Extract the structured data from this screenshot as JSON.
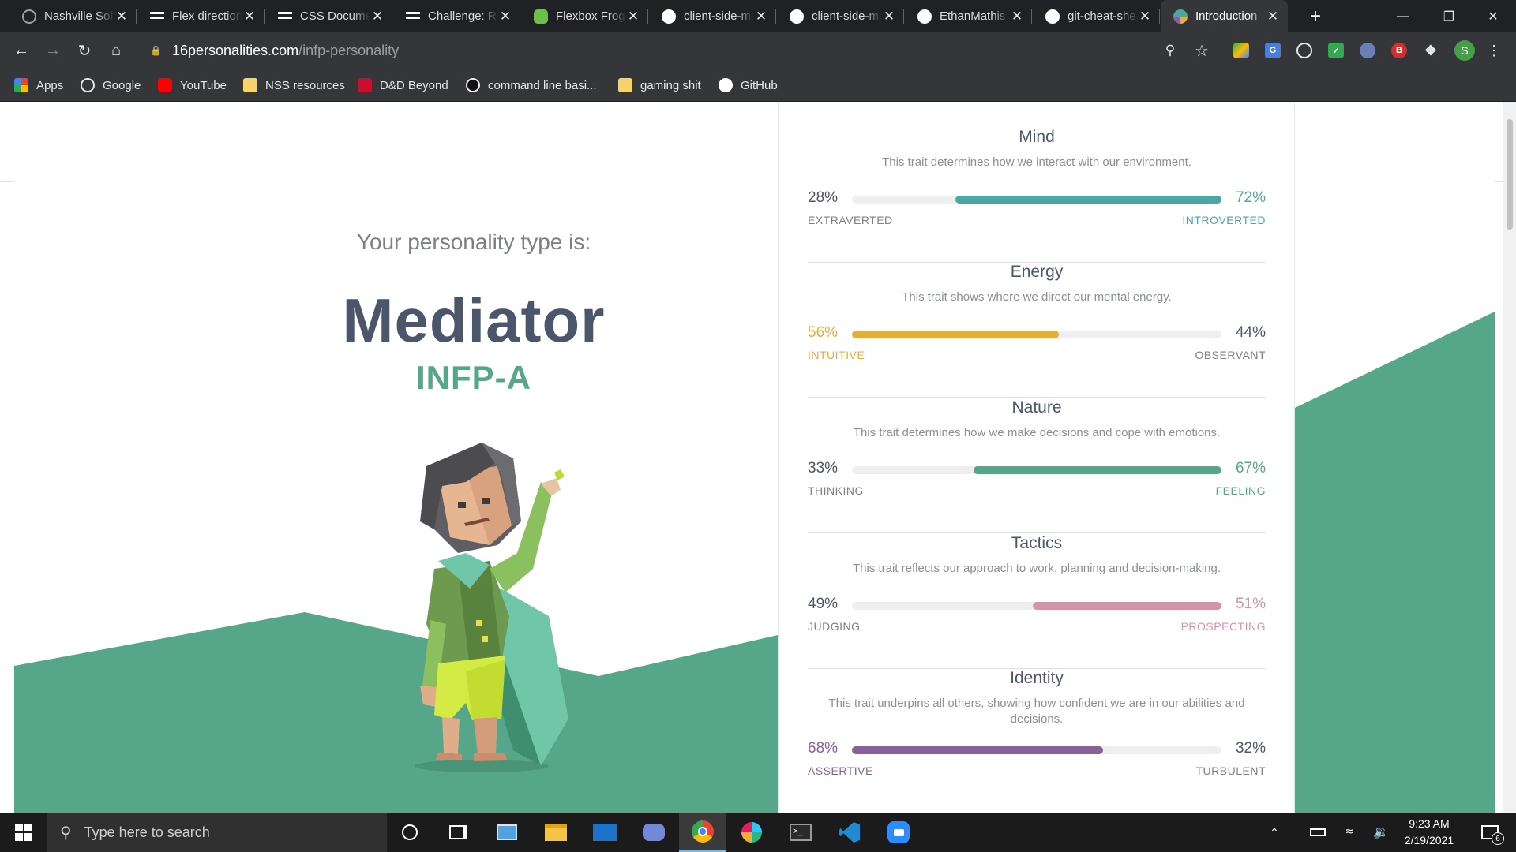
{
  "tabs": [
    {
      "title": "Nashville Software",
      "icon": "globe-icon"
    },
    {
      "title": "Flex direction",
      "icon": "flexbox-icon"
    },
    {
      "title": "CSS Document",
      "icon": "flexbox-icon"
    },
    {
      "title": "Challenge: Reading",
      "icon": "flexbox-icon"
    },
    {
      "title": "Flexbox Froggy",
      "icon": "frog-icon"
    },
    {
      "title": "client-side-mastery",
      "icon": "github-icon"
    },
    {
      "title": "client-side-mastery",
      "icon": "github-icon"
    },
    {
      "title": "EthanMathis",
      "icon": "github-icon"
    },
    {
      "title": "git-cheat-sheet",
      "icon": "github-icon"
    },
    {
      "title": "Introduction",
      "icon": "16p-icon",
      "active": true
    }
  ],
  "address": {
    "host": "16personalities.com",
    "path": "/infp-personality"
  },
  "bookmarks": [
    {
      "label": "Apps",
      "icon": "apps-grid-icon"
    },
    {
      "label": "Google",
      "icon": "globe-icon"
    },
    {
      "label": "YouTube",
      "icon": "youtube-icon"
    },
    {
      "label": "NSS resources",
      "icon": "folder-icon"
    },
    {
      "label": "D&D Beyond",
      "icon": "dndbeyond-icon"
    },
    {
      "label": "command line basi...",
      "icon": "codecademy-icon"
    },
    {
      "label": "gaming shit",
      "icon": "folder-icon"
    },
    {
      "label": "GitHub",
      "icon": "github-icon"
    }
  ],
  "profile": {
    "initial": "S"
  },
  "hero": {
    "intro": "Your personality type is:",
    "name": "Mediator",
    "code": "INFP-A"
  },
  "traits": [
    {
      "title": "Mind",
      "desc": "This trait determines how we interact with our environment.",
      "left_pct": "28%",
      "right_pct": "72%",
      "left_label": "EXTRAVERTED",
      "right_label": "INTROVERTED",
      "dominant": "right",
      "value": 0.72,
      "color": "#4aa7a5"
    },
    {
      "title": "Energy",
      "desc": "This trait shows where we direct our mental energy.",
      "left_pct": "56%",
      "right_pct": "44%",
      "left_label": "INTUITIVE",
      "right_label": "OBSERVANT",
      "dominant": "left",
      "value": 0.56,
      "color": "#e4ae3a"
    },
    {
      "title": "Nature",
      "desc": "This trait determines how we make decisions and cope with emotions.",
      "left_pct": "33%",
      "right_pct": "67%",
      "left_label": "THINKING",
      "right_label": "FEELING",
      "dominant": "right",
      "value": 0.67,
      "color": "#56a789"
    },
    {
      "title": "Tactics",
      "desc": "This trait reflects our approach to work, planning and decision-making.",
      "left_pct": "49%",
      "right_pct": "51%",
      "left_label": "JUDGING",
      "right_label": "PROSPECTING",
      "dominant": "right",
      "value": 0.51,
      "color": "#d494a8"
    },
    {
      "title": "Identity",
      "desc": "This trait underpins all others, showing how confident we are in our abilities and decisions.",
      "left_pct": "68%",
      "right_pct": "32%",
      "left_label": "ASSERTIVE",
      "right_label": "TURBULENT",
      "dominant": "left",
      "value": 0.68,
      "color": "#88619a"
    }
  ],
  "colors": {
    "neutral_text": "#4c566b",
    "neutral_label": "#7d7f88",
    "landscape": "#56a789"
  },
  "taskbar": {
    "search_placeholder": "Type here to search",
    "time": "9:23 AM",
    "date": "2/19/2021",
    "notifications": "6"
  }
}
